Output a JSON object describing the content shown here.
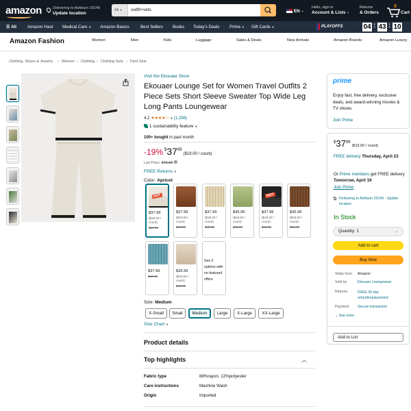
{
  "header": {
    "logo_text": "amazon",
    "location_line1": "Delivering to Ashburn 20149",
    "location_line2": "Update location",
    "search_category": "All",
    "search_query": "outfit+sets",
    "language": "EN",
    "account_line1": "Hello, sign in",
    "account_line2": "Account & Lists",
    "returns_line1": "Returns",
    "returns_line2": "& Orders",
    "cart_count": "0",
    "cart_label": "Cart"
  },
  "subnav": {
    "all_label": "All",
    "items": [
      "Amazon Haul",
      "Medical Care",
      "Amazon Basics",
      "Best Sellers",
      "Books",
      "Today's Deals",
      "Prime",
      "Gift Cards"
    ],
    "promo_text": "PLAYOFFS",
    "countdown": [
      "04",
      "43",
      "10"
    ]
  },
  "store_nav": {
    "title": "Amazon Fashion",
    "items": [
      "Women",
      "Men",
      "Kids",
      "Luggage",
      "Sales & Deals",
      "New Arrivals",
      "Amazon Brands",
      "Amazon Luxury"
    ]
  },
  "breadcrumb": [
    "Clothing, Shoes & Jewelry",
    "Women",
    "Clothing",
    "Clothing Sets",
    "Pant Sets"
  ],
  "product": {
    "store_link": "Visit the Ekouaer Store",
    "title": "Ekouaer Lounge Set for Women Travel Outfits 2 Piece Sets Short Sleeve Sweater Top Wide Leg Long Pants Loungewear",
    "rating_value": "4.2",
    "rating_count": "(1,298)",
    "stars_display": "★★★★☆",
    "sustainability": "1 sustainability feature",
    "bought_bold": "100+ bought",
    "bought_rest": " in past month",
    "discount": "-19%",
    "price_symbol": "$",
    "price_whole": "37",
    "price_fraction": "99",
    "price_unit": "($19.00 / count)",
    "list_price_label": "List Price: ",
    "list_price": "$46.99",
    "returns": "FREE Returns",
    "color_label": "Color: ",
    "color_value": "Apricot",
    "swatches": [
      {
        "price": "$37.99",
        "unit": "($19.00 / count)",
        "strike": "$46.99",
        "hot": "HOT"
      },
      {
        "price": "$37.99",
        "unit": "($19.00 / count)",
        "strike": "$46.99",
        "hot": ""
      },
      {
        "price": "$37.99",
        "unit": "($19.00 / count)",
        "strike": "$46.99",
        "hot": ""
      },
      {
        "price": "$36.99",
        "unit": "($18.50 / count)",
        "strike": "$46.99",
        "hot": ""
      },
      {
        "price": "$37.99",
        "unit": "($19.00 / count)",
        "strike": "$46.99",
        "hot": "HOT"
      },
      {
        "price": "$36.99",
        "unit": "($18.50 / count)",
        "strike": "$46.99",
        "hot": ""
      },
      {
        "price": "$37.99",
        "unit": "",
        "strike": "$46.99",
        "hot": ""
      },
      {
        "price": "$36.99",
        "unit": "($18.50 / count)",
        "strike": "$46.99",
        "hot": ""
      }
    ],
    "more_options": "See 2 options with no featured offers",
    "size_label": "Size: ",
    "size_value": "Medium",
    "sizes": [
      "X-Small",
      "Small",
      "Medium",
      "Large",
      "X-Large",
      "XX-Large"
    ],
    "size_chart": "Size Chart",
    "details_heading": "Product details",
    "highlights_heading": "Top highlights",
    "attributes": [
      {
        "key": "Fabric type",
        "value": "88%rayon, 12%polyester"
      },
      {
        "key": "Care instructions",
        "value": "Machine Wash"
      },
      {
        "key": "Origin",
        "value": "Imported"
      }
    ]
  },
  "prime_box": {
    "logo": "prime",
    "text": "Enjoy fast, free delivery, exclusive deals, and award-winning movies & TV shows.",
    "join": "Join Prime"
  },
  "buy_box": {
    "price_symbol": "$",
    "price_whole": "37",
    "price_fraction": "99",
    "price_unit": "($19.00 / count)",
    "free_delivery": "FREE delivery ",
    "delivery_date": "Thursday, April 23",
    "or_text": "Or ",
    "prime_members": "Prime members",
    "get_free": " get FREE delivery ",
    "fast_date": "Tomorrow, April 19",
    "join_prime": "Join Prime",
    "location": "Delivering to Ashburn 20149 - Update location",
    "stock": "In Stock",
    "quantity": "Quantity: 1",
    "add_to_cart": "Add to cart",
    "buy_now": "Buy Now",
    "info": [
      {
        "key": "Ships from",
        "value": "Amazon"
      },
      {
        "key": "Sold by",
        "value": "Ekouaer Loungewear"
      },
      {
        "key": "Returns",
        "value": "FREE 30-day refund/replacement"
      },
      {
        "key": "Payment",
        "value": "Secure transaction"
      }
    ],
    "see_more": "See more",
    "add_to_list": "Add to List"
  },
  "colors": {
    "nav": "#131921",
    "subnav": "#232f3e",
    "accent": "#febd69",
    "link": "#007185",
    "deal": "#cc0c39",
    "stock": "#007600",
    "add_cart": "#ffd814",
    "buy_now": "#ffa41c"
  }
}
